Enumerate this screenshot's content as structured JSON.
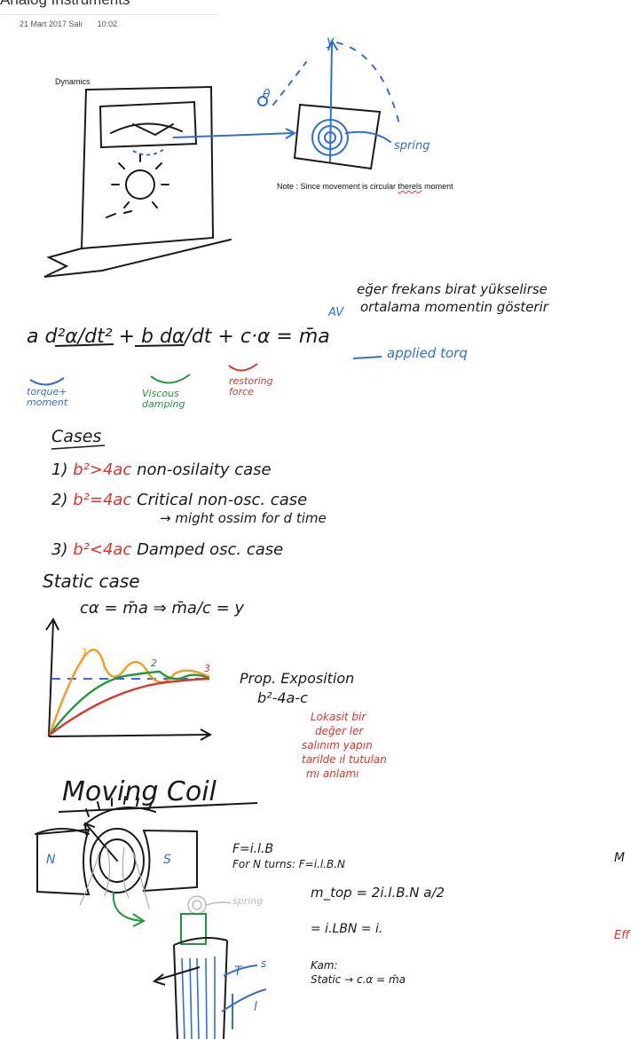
{
  "page": {
    "title": "Analog Instruments",
    "date": "21 Mart 2017 Salı",
    "time": "10:02"
  },
  "typed_text": {
    "dynamics": "Dynamics",
    "note_prefix": "Note : Since movement is circular ",
    "note_misspelled": "therels",
    "note_suffix": " moment"
  },
  "handwriting": {
    "spring_label": "spring",
    "theta_label": "θ",
    "y_label": "y",
    "turkish_note_1": "eğer frekans birat yükselirse",
    "turkish_note_2": "ortalama momentin gösterir",
    "av": "AV",
    "equation": "a d²α/dt² + b dα/dt + c·α = m̄a",
    "applied_torque": "applied torq",
    "torque_moment": "torque+ moment",
    "viscous_damping": "Viscous damping",
    "restoring_force": "restoring force",
    "cases_heading": "Cases",
    "case_1_prefix": "1)",
    "case_1_condition": "b²>4ac",
    "case_1_text": "non-osilaity case",
    "case_2_prefix": "2)",
    "case_2_condition": "b²=4ac",
    "case_2_text": "Critical non-osc. case",
    "case_2_sub": "→ might ossim for d time",
    "case_3_prefix": "3)",
    "case_3_condition": "b²<4ac",
    "case_3_text": "Damped osc. case",
    "static_case": "Static case",
    "static_equation": "cα = m̄a  ⇒  m̄a/c = y",
    "prop_exposition": "Prop. Exposition",
    "prop_expression": "b²-4a-c",
    "red_note_1": "Lokasit bir",
    "red_note_2": "değer ler",
    "red_note_3": "salınım yapın",
    "red_note_4": "tarilde ıl tutulan",
    "red_note_5": "mı anlamı",
    "moving_coil": "Moving Coil",
    "N": "N",
    "S": "S",
    "force_eq": "F=i.l.B",
    "n_turns_eq": "For N turns: F=i.l.B.N",
    "torque_eq": "m_top = 2i.l.B.N a/2",
    "torque_simplified": "= i.LBN = i.",
    "kam": "Kam:",
    "static_arrow": "Static → c.α = m̄a",
    "spring_label_2": "spring",
    "T_label": "T",
    "s_label": "s",
    "l_label": "l",
    "edge_mi": "M",
    "edge_eff": "Eff"
  },
  "chart_data": {
    "type": "line",
    "title": "",
    "xlabel": "",
    "ylabel": "",
    "series": [
      {
        "name": "1",
        "color": "#f29b1f"
      },
      {
        "name": "2",
        "color": "#1f9a3a"
      },
      {
        "name": "3",
        "color": "#e0332b"
      }
    ],
    "colors": {
      "setpoint": "#2f6fd6"
    }
  }
}
